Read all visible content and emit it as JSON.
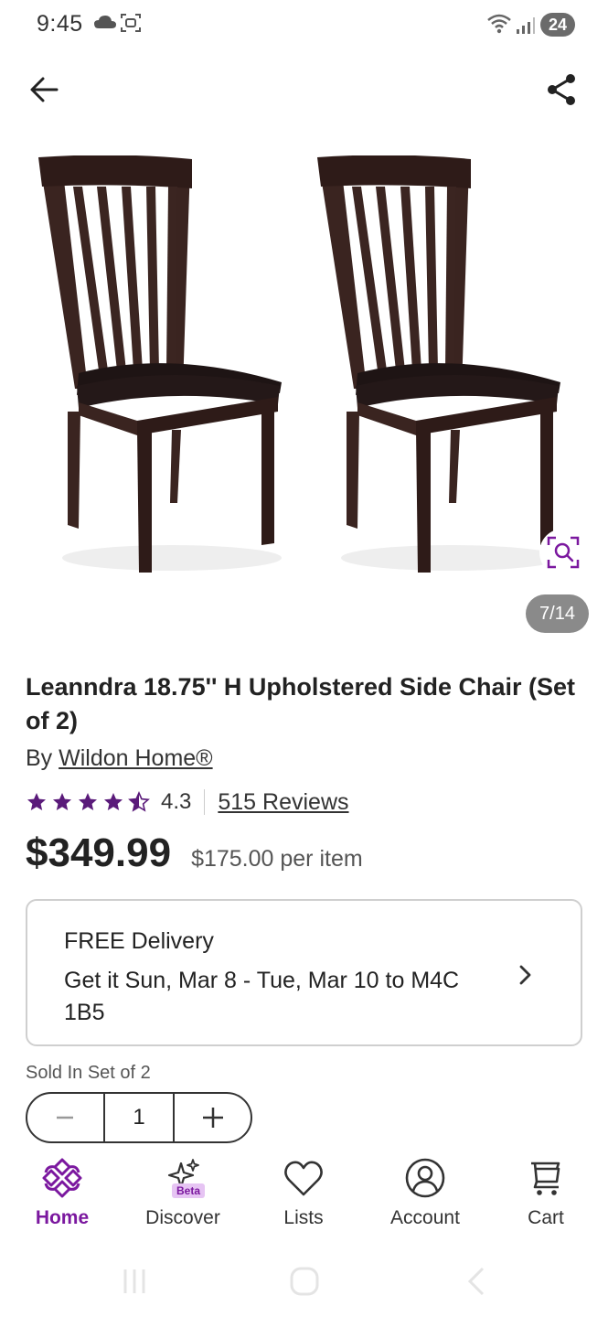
{
  "status_bar": {
    "time": "9:45",
    "battery": "24"
  },
  "gallery": {
    "counter": "7/14"
  },
  "product": {
    "title": "Leanndra 18.75'' H Upholstered Side Chair (Set of 2)",
    "by_prefix": "By ",
    "brand": "Wildon Home®",
    "rating": "4.3",
    "rating_value": 4.3,
    "reviews": "515 Reviews",
    "price": "$349.99",
    "unit_price": "$175.00 per item"
  },
  "delivery": {
    "title": "FREE Delivery",
    "text": "Get it Sun, Mar 8 - Tue, Mar 10 to M4C 1B5"
  },
  "quantity": {
    "sold_in": "Sold In Set of 2",
    "value": "1"
  },
  "nav": {
    "home": "Home",
    "discover": "Discover",
    "beta": "Beta",
    "lists": "Lists",
    "account": "Account",
    "cart": "Cart"
  },
  "colors": {
    "accent": "#7b189f",
    "star": "#5a1a7a"
  }
}
